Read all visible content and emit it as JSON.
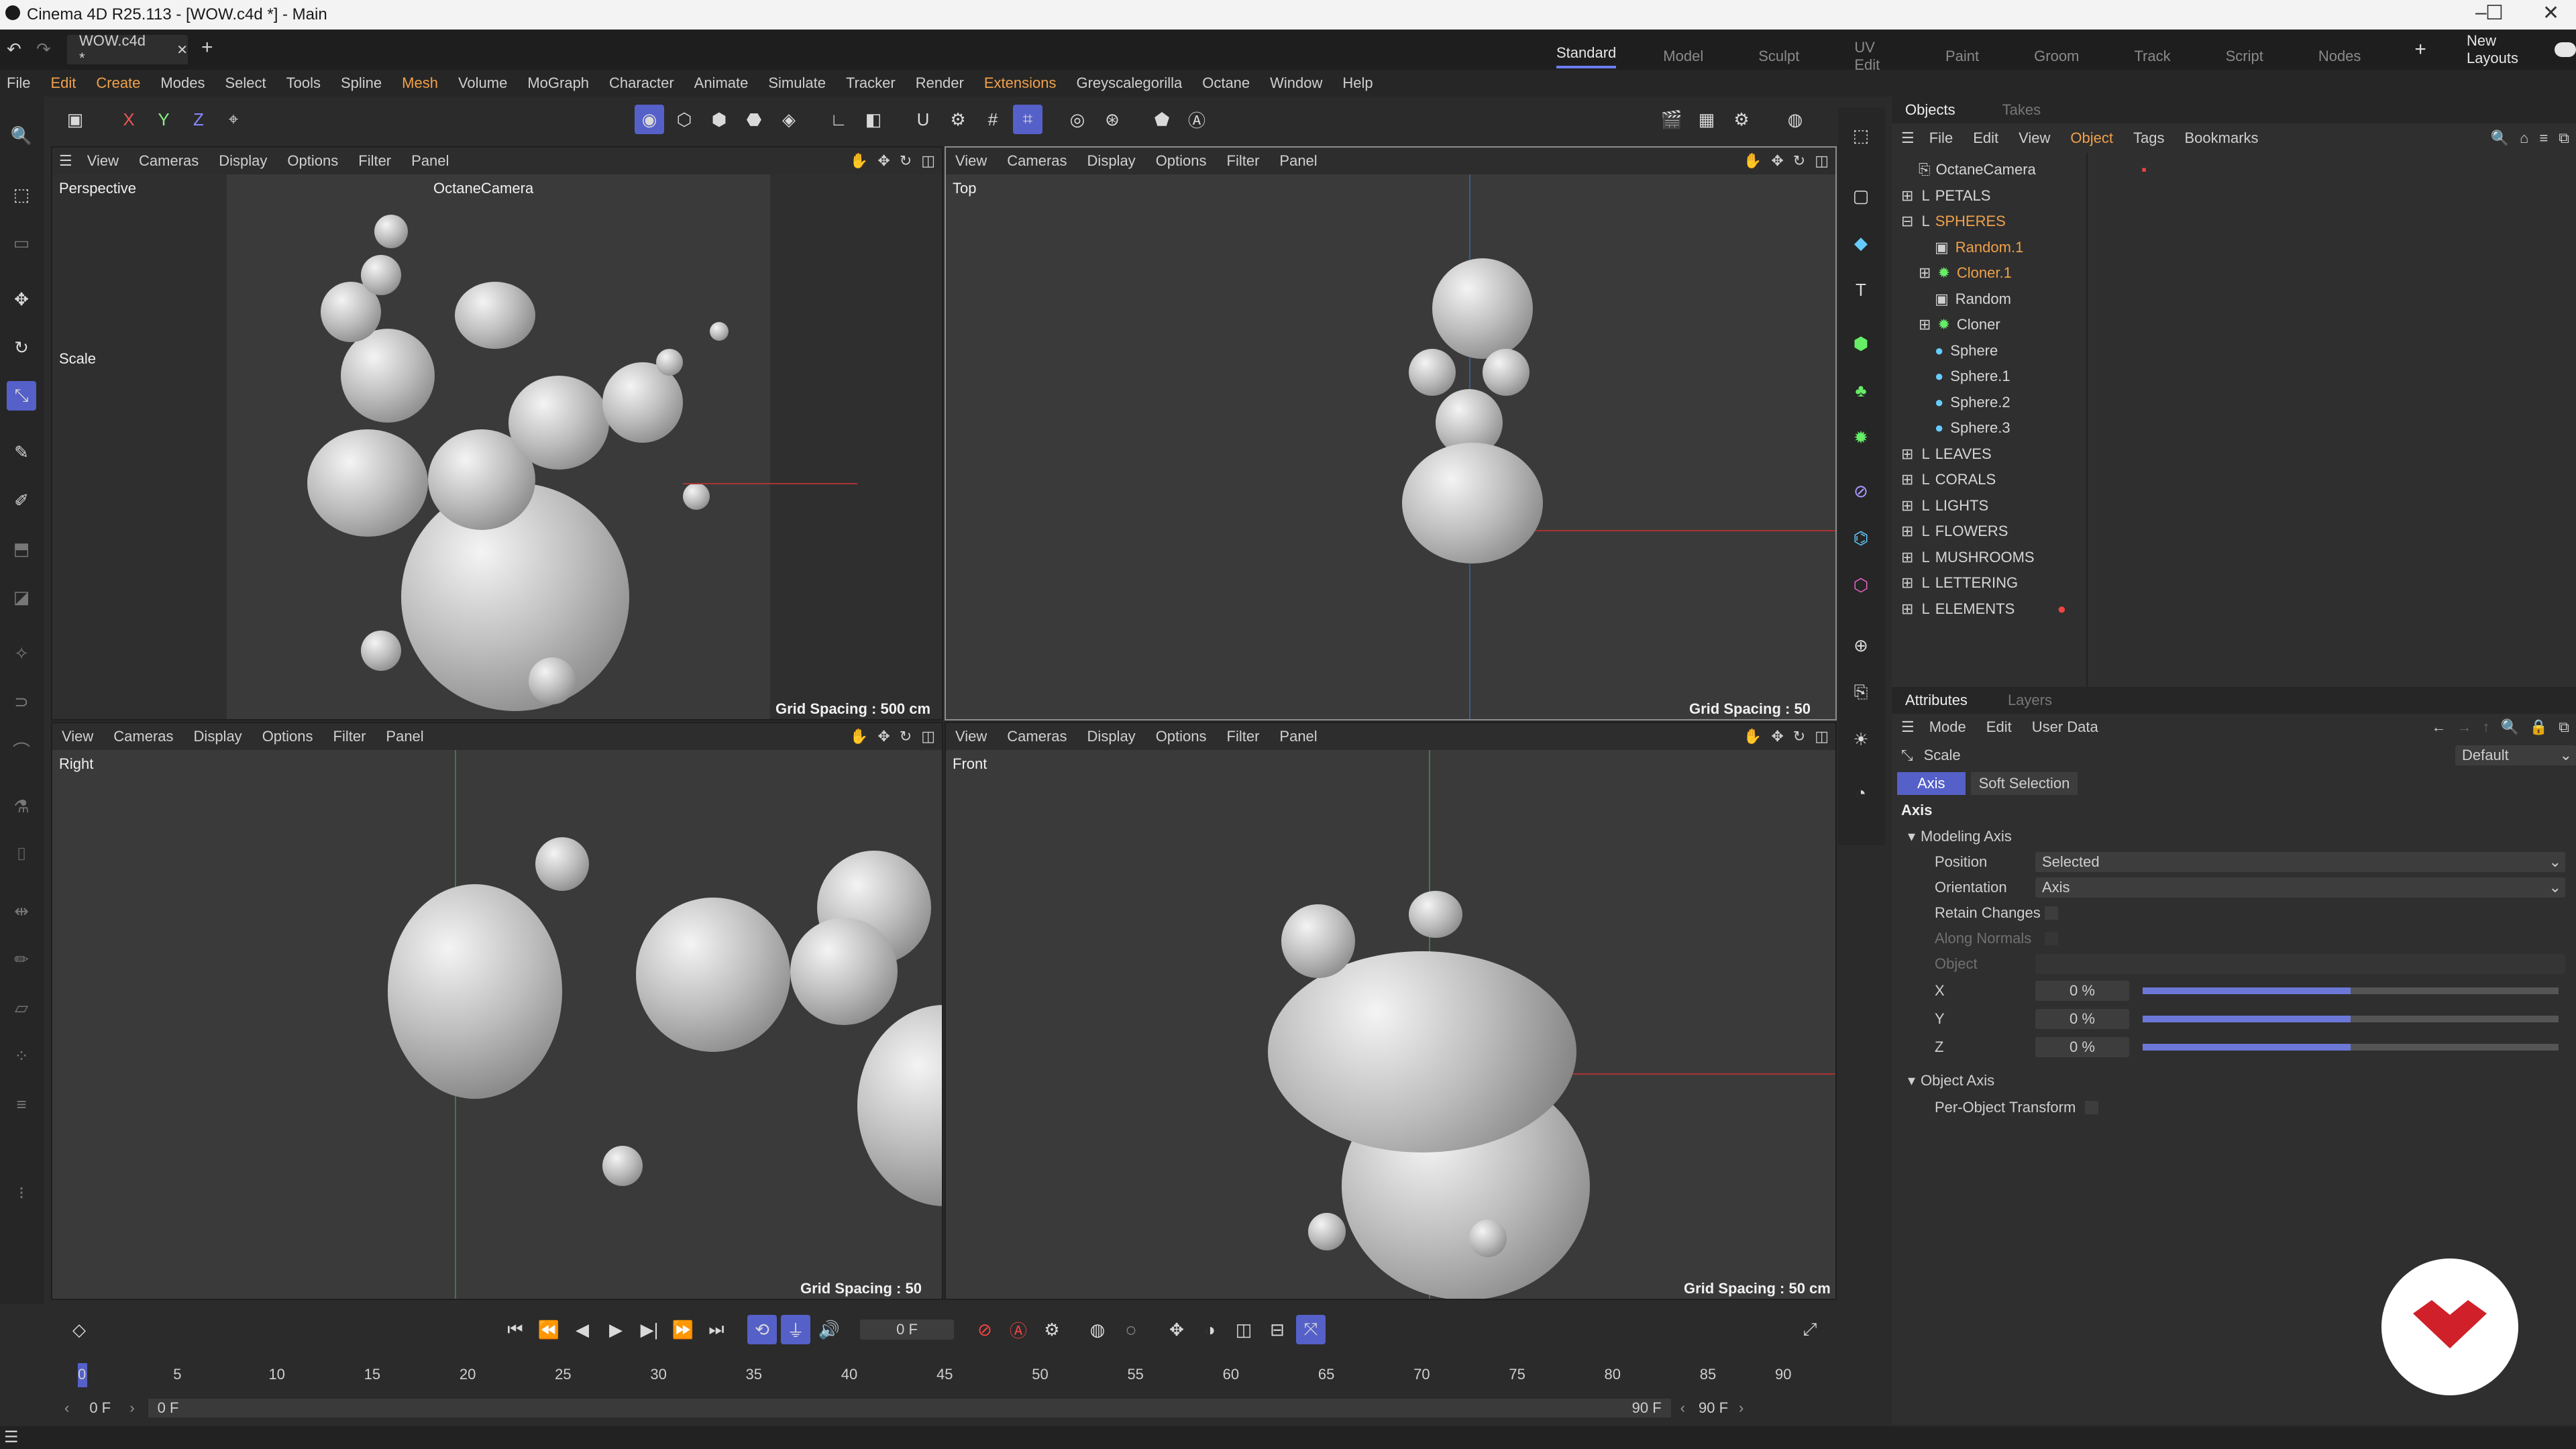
{
  "window": {
    "title": "Cinema 4D R25.113 - [WOW.c4d *] - Main"
  },
  "tabs": {
    "doc_tab": "WOW.c4d *",
    "layouts": [
      "Standard",
      "Model",
      "Sculpt",
      "UV Edit",
      "Paint",
      "Groom",
      "Track",
      "Script",
      "Nodes"
    ],
    "new_layouts": "New Layouts"
  },
  "menu": [
    "File",
    "Edit",
    "Create",
    "Modes",
    "Select",
    "Tools",
    "Spline",
    "Mesh",
    "Volume",
    "MoGraph",
    "Character",
    "Animate",
    "Simulate",
    "Tracker",
    "Render",
    "Extensions",
    "Greyscalegorilla",
    "Octane",
    "Window",
    "Help"
  ],
  "axis_buttons": [
    "X",
    "Y",
    "Z"
  ],
  "viewport_menu": [
    "View",
    "Cameras",
    "Display",
    "Options",
    "Filter",
    "Panel"
  ],
  "viewports": {
    "perspective": {
      "label": "Perspective",
      "camera": "OctaneCamera",
      "grid": "Grid Spacing : 500 cm",
      "tool": "Scale"
    },
    "top": {
      "label": "Top",
      "grid": "Grid Spacing : 50 cm"
    },
    "right": {
      "label": "Right",
      "grid": "Grid Spacing : 50 cm"
    },
    "front": {
      "label": "Front",
      "grid": "Grid Spacing : 50 cm"
    }
  },
  "objects_panel": {
    "tabs": [
      "Objects",
      "Takes"
    ],
    "menu": [
      "File",
      "Edit",
      "View",
      "Object",
      "Tags",
      "Bookmarks"
    ],
    "rows": [
      {
        "name": "OctaneCamera",
        "color": "#d6d6d6"
      },
      {
        "name": "PETALS",
        "color": "#d6d6d6"
      },
      {
        "name": "SPHERES",
        "color": "#f0a14a"
      },
      {
        "name": "Random.1",
        "color": "#f0a14a"
      },
      {
        "name": "Cloner.1",
        "color": "#f0a14a"
      },
      {
        "name": "Random",
        "color": "#d6d6d6"
      },
      {
        "name": "Cloner",
        "color": "#d6d6d6"
      },
      {
        "name": "Sphere",
        "color": "#d6d6d6"
      },
      {
        "name": "Sphere.1",
        "color": "#d6d6d6"
      },
      {
        "name": "Sphere.2",
        "color": "#d6d6d6"
      },
      {
        "name": "Sphere.3",
        "color": "#d6d6d6"
      },
      {
        "name": "LEAVES",
        "color": "#d6d6d6"
      },
      {
        "name": "CORALS",
        "color": "#d6d6d6"
      },
      {
        "name": "LIGHTS",
        "color": "#d6d6d6"
      },
      {
        "name": "FLOWERS",
        "color": "#d6d6d6"
      },
      {
        "name": "MUSHROOMS",
        "color": "#d6d6d6"
      },
      {
        "name": "LETTERING",
        "color": "#d6d6d6"
      },
      {
        "name": "ELEMENTS",
        "color": "#d6d6d6"
      }
    ]
  },
  "attributes": {
    "tabs": [
      "Attributes",
      "Layers"
    ],
    "menu": [
      "Mode",
      "Edit",
      "User Data"
    ],
    "tool": "Scale",
    "preset": "Default",
    "subtabs": [
      "Axis",
      "Soft Selection"
    ],
    "section": "Axis",
    "group1": "Modeling Axis",
    "position_label": "Position",
    "position_value": "Selected",
    "orientation_label": "Orientation",
    "orientation_value": "Axis",
    "retain": "Retain Changes",
    "along": "Along Normals",
    "object": "Object",
    "axes": [
      {
        "label": "X",
        "value": "0 %"
      },
      {
        "label": "Y",
        "value": "0 %"
      },
      {
        "label": "Z",
        "value": "0 %"
      }
    ],
    "axis_slider_fraction": 0.5,
    "group2": "Object Axis",
    "per_object": "Per-Object Transform"
  },
  "timeline": {
    "current_frame": "0 F",
    "start": "0 F",
    "range_start": "0 F",
    "range_end": "90 F",
    "end": "90 F",
    "ticks": [
      "0",
      "5",
      "10",
      "15",
      "20",
      "25",
      "30",
      "35",
      "40",
      "45",
      "50",
      "55",
      "60",
      "65",
      "70",
      "75",
      "80",
      "85",
      "90"
    ]
  },
  "colors": {
    "accent": "#5560c8",
    "orange": "#f0a14a",
    "logo_red": "#d0202a"
  }
}
